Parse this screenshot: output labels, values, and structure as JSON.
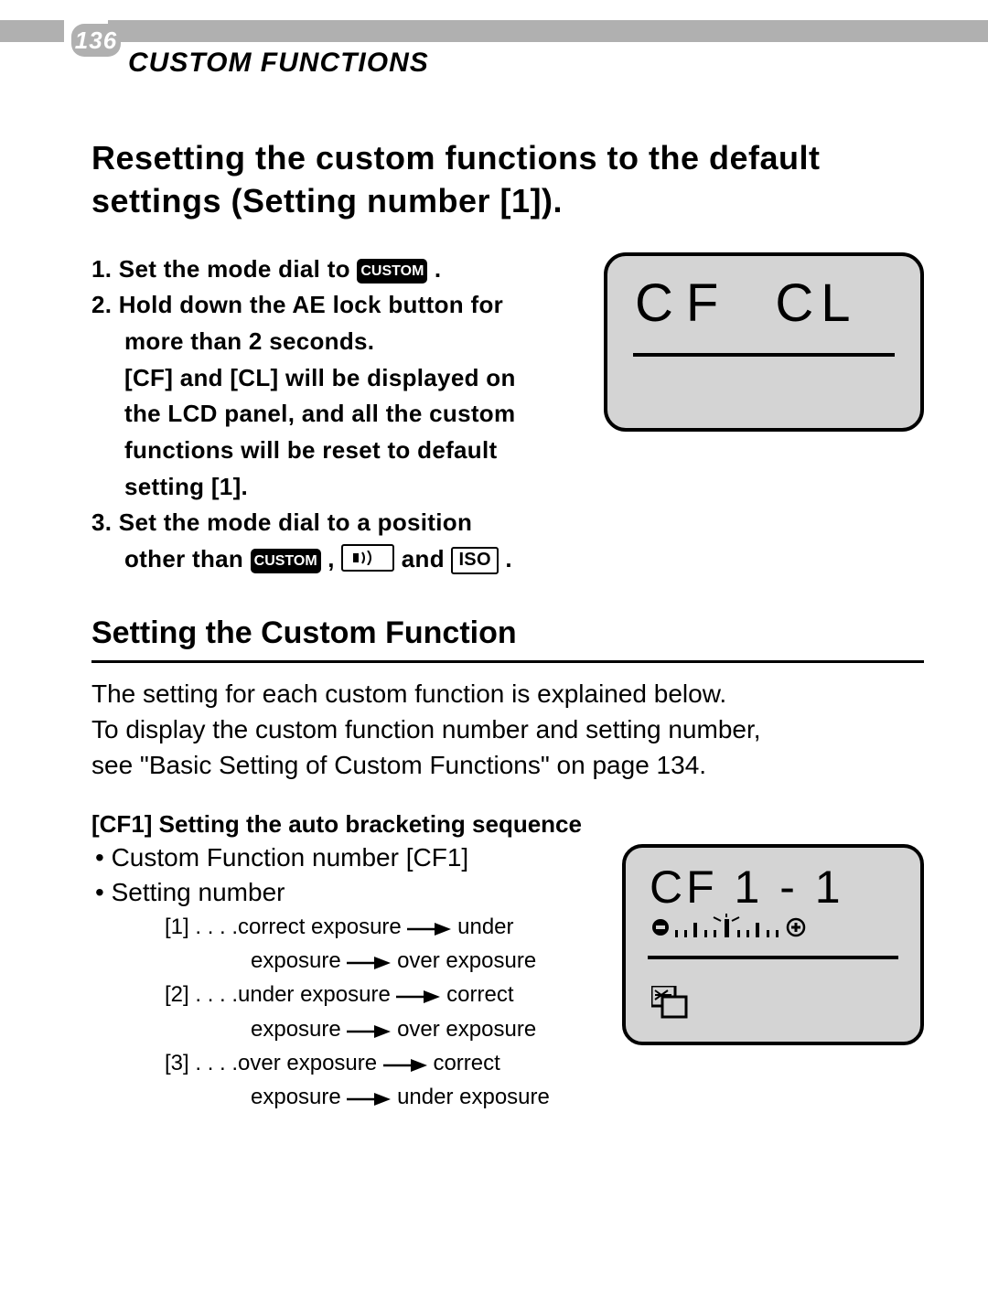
{
  "page_number": "136",
  "section_title": "CUSTOM FUNCTIONS",
  "heading1_l1": "Resetting the custom functions to the default",
  "heading1_l2": "settings (Setting number [1]).",
  "steps": {
    "s1_prefix": "1. Set the mode dial to ",
    "s1_suffix": " .",
    "custom_chip": "CUSTOM",
    "s2_l1": "2. Hold down the AE lock button for",
    "s2_l2": "more than 2 seconds.",
    "s2_l3": "[CF] and [CL] will be displayed on",
    "s2_l4": "the LCD panel, and all the custom",
    "s2_l5": "functions will be reset to default",
    "s2_l6": "setting [1].",
    "s3_l1": "3. Set the mode dial to a position",
    "s3_l2a": "other than ",
    "s3_l2b": " , ",
    "s3_l2c": "  and ",
    "s3_l2d": " .",
    "iso_chip": "ISO"
  },
  "lcd1": {
    "text_left": "CF",
    "text_right": "CL"
  },
  "h2": "Setting the Custom Function",
  "body_l1": "The setting for each custom function is explained below.",
  "body_l2": " To display the custom function number and setting number,",
  "body_l3": "see \"Basic Setting of Custom Functions\" on page 134.",
  "cf1": {
    "title": "[CF1]  Setting the auto bracketing sequence",
    "bullet1": "•  Custom Function number [CF1]",
    "bullet2": "•  Setting number",
    "opt1a": "[1] . . . .correct exposure ",
    "opt1b": " under",
    "opt1c": "exposure ",
    "opt1d": " over exposure",
    "opt2a": "[2] . . . .under exposure ",
    "opt2b": " correct",
    "opt2c": "exposure ",
    "opt2d": " over exposure",
    "opt3a": "[3] . . . .over exposure ",
    "opt3b": " correct",
    "opt3c": "exposure ",
    "opt3d": " under exposure"
  },
  "lcd2": {
    "text": "CF  1 - 1"
  }
}
